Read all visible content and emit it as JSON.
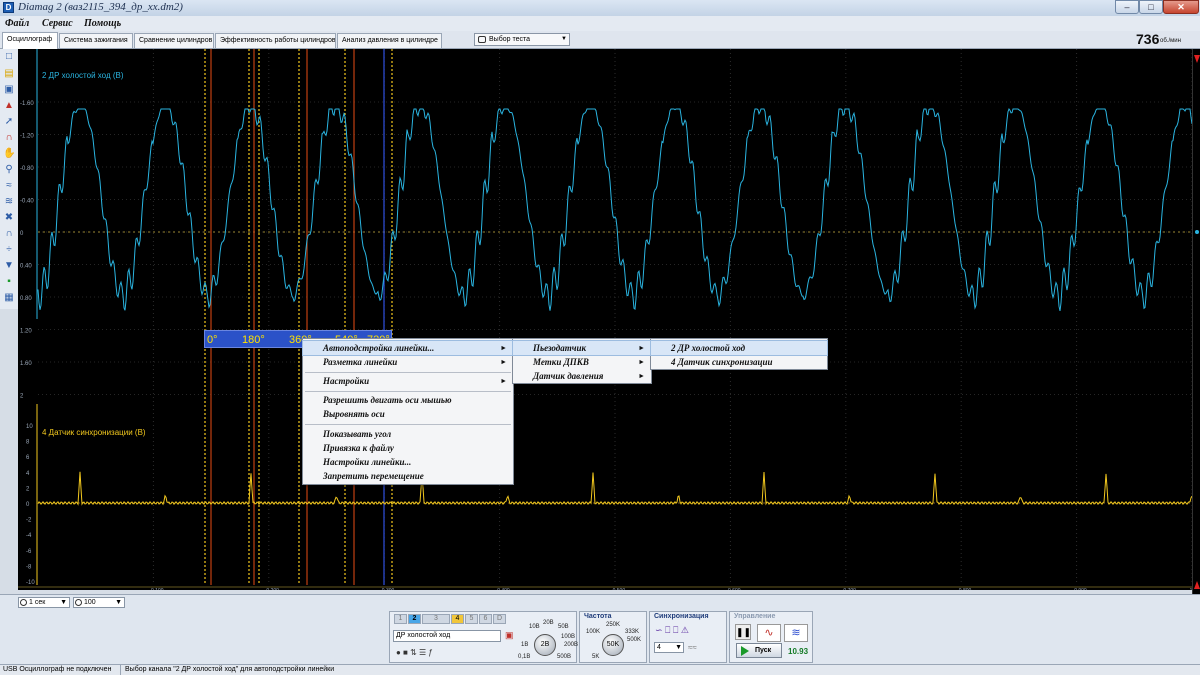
{
  "window": {
    "title": "Diamag 2 (ваз2115_394_др_хх.dm2)",
    "app_icon": "D"
  },
  "menu": [
    "Файл",
    "Сервис",
    "Помощь"
  ],
  "tabs": [
    {
      "label": "Осциллограф",
      "active": true
    },
    {
      "label": "Система зажигания",
      "active": false
    },
    {
      "label": "Сравнение цилиндров",
      "active": false
    },
    {
      "label": "Эффективность работы цилиндров",
      "active": false
    },
    {
      "label": "Анализ давления в цилиндре",
      "active": false
    }
  ],
  "test_select": {
    "label": "Выбор теста"
  },
  "rpm": {
    "value": "736",
    "unit": "об./мин"
  },
  "channels": {
    "ch2": {
      "label": "2 ДР холостой ход (В)",
      "color": "#2ab4e0",
      "ticks": [
        "-1.60",
        "-1.20",
        "-0.80",
        "-0.40",
        "0",
        "0.40",
        "0.80",
        "1.20",
        "1.60",
        "2"
      ]
    },
    "ch4": {
      "label": "4 Датчик синхронизации (В)",
      "color": "#f2c81e",
      "ticks": [
        "10",
        "8",
        "6",
        "4",
        "2",
        "0",
        "-2",
        "-4",
        "-6",
        "-8",
        "-10"
      ]
    }
  },
  "x_ticks": [
    "0.100",
    "0.200",
    "0.300",
    "0.400",
    "0.500",
    "0.600",
    "0.700",
    "0.800",
    "0.900",
    "1.000"
  ],
  "ruler": {
    "labels": [
      "0°",
      "180°",
      "360°",
      "540°",
      "720°"
    ]
  },
  "context_menu": {
    "items": [
      {
        "label": "Автоподстройка линейки...",
        "submenu": true,
        "highlight": true
      },
      {
        "label": "Разметка линейки",
        "submenu": true
      },
      {
        "sep": true
      },
      {
        "label": "Настройки",
        "submenu": true
      },
      {
        "sep": true
      },
      {
        "label": "Разрешить двигать оси мышью"
      },
      {
        "label": "Выровнять оси"
      },
      {
        "sep": true
      },
      {
        "label": "Показывать угол"
      },
      {
        "label": "Привязка к файлу"
      },
      {
        "label": "Настройки линейки..."
      },
      {
        "label": "Запретить перемещение"
      }
    ],
    "sub1": [
      {
        "label": "Пьезодатчик",
        "submenu": true,
        "highlight": true
      },
      {
        "label": "Метки ДПКВ",
        "submenu": true
      },
      {
        "label": "Датчик давления",
        "submenu": true
      }
    ],
    "sub2": [
      {
        "label": "2  ДР холостой ход",
        "highlight": true
      },
      {
        "label": "4  Датчик синхронизации"
      }
    ]
  },
  "zoom": {
    "time": "1 сек",
    "amp": "100"
  },
  "channel_panel": {
    "tabs": [
      "1",
      "2",
      "3",
      "4",
      "5",
      "6",
      "D"
    ],
    "name": "ДР холостой ход",
    "knob_value": "2В",
    "knob_labels": [
      "10В",
      "20В",
      "50В",
      "100В",
      "200В",
      "500В",
      "1В",
      "0,1В"
    ]
  },
  "freq_panel": {
    "title": "Частота",
    "knob_value": "50K",
    "labels": [
      "250K",
      "100K",
      "333K",
      "500K",
      "5K"
    ]
  },
  "sync_panel": {
    "title": "Синхронизация",
    "channel": "4"
  },
  "control_panel": {
    "title": "Управление",
    "run_label": "Пуск",
    "time": "10.93"
  },
  "status": {
    "left": "USB Осциллограф не подключен",
    "right": "Выбор канала \"2  ДР холостой ход\" для автоподстройки линейки"
  }
}
